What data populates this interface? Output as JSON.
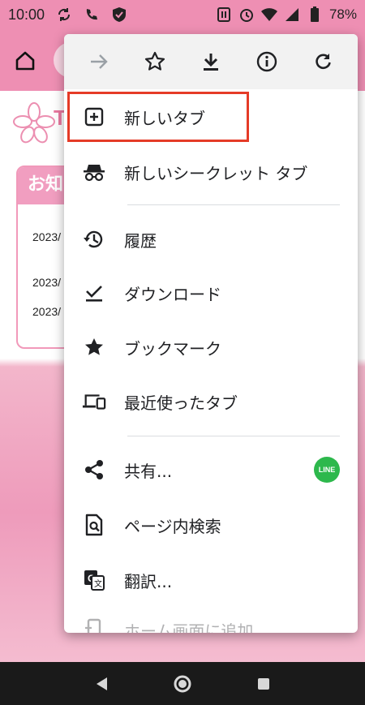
{
  "status_bar": {
    "time": "10:00",
    "battery": "78%"
  },
  "page": {
    "logo_text": "T",
    "notice_title": "お知",
    "notice_rows": [
      "2023/",
      "2023/",
      "2023/"
    ]
  },
  "menu": {
    "top_actions": [
      {
        "icon": "forward-icon",
        "enabled": false
      },
      {
        "icon": "star-outline-icon",
        "enabled": true
      },
      {
        "icon": "download-icon",
        "enabled": true
      },
      {
        "icon": "info-icon",
        "enabled": true
      },
      {
        "icon": "refresh-icon",
        "enabled": true
      }
    ],
    "items": {
      "new_tab": "新しいタブ",
      "new_incognito_tab": "新しいシークレット タブ",
      "history": "履歴",
      "downloads": "ダウンロード",
      "bookmarks": "ブックマーク",
      "recent_tabs": "最近使ったタブ",
      "share": "共有...",
      "find_in_page": "ページ内検索",
      "translate": "翻訳...",
      "add_to_home": "ホーム画面に追加"
    },
    "share_app_badge": "LINE"
  },
  "colors": {
    "highlight": "#e53b27",
    "line_green": "#2db84c",
    "brand_pink": "#ee8fb3"
  }
}
